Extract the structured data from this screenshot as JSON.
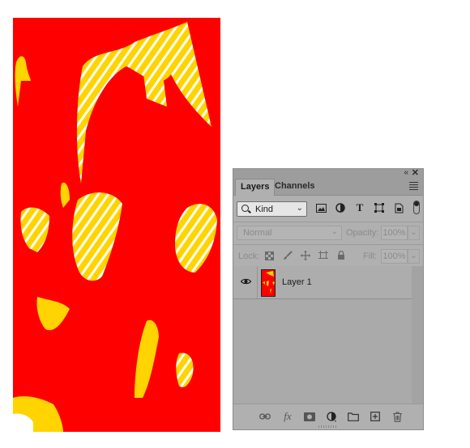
{
  "colors": {
    "canvas": "#ff0000",
    "panel_bg": "#b0b0b0",
    "accent_yellow": "#ffd400"
  },
  "panel": {
    "tabs": [
      {
        "label": "Layers",
        "active": true
      },
      {
        "label": "Channels",
        "active": false
      }
    ],
    "collapse_glyph": "«",
    "close_glyph": "✕",
    "filter": {
      "kind_label": "Kind",
      "icons": [
        "pixel-filter-icon",
        "adjustment-filter-icon",
        "type-filter-icon",
        "shape-filter-icon",
        "smart-object-filter-icon"
      ],
      "type_glyph": "T"
    },
    "blend": {
      "mode": "Normal",
      "opacity_label": "Opacity:",
      "opacity_value": "100%"
    },
    "lock": {
      "label": "Lock:",
      "fill_label": "Fill:",
      "fill_value": "100%"
    },
    "layers": [
      {
        "name": "Layer 1",
        "visible": true
      }
    ],
    "footer_icons": [
      "link-layers-icon",
      "fx-icon",
      "add-mask-icon",
      "adjustment-layer-icon",
      "new-group-icon",
      "new-layer-icon",
      "delete-icon"
    ],
    "fx_label": "fx"
  }
}
